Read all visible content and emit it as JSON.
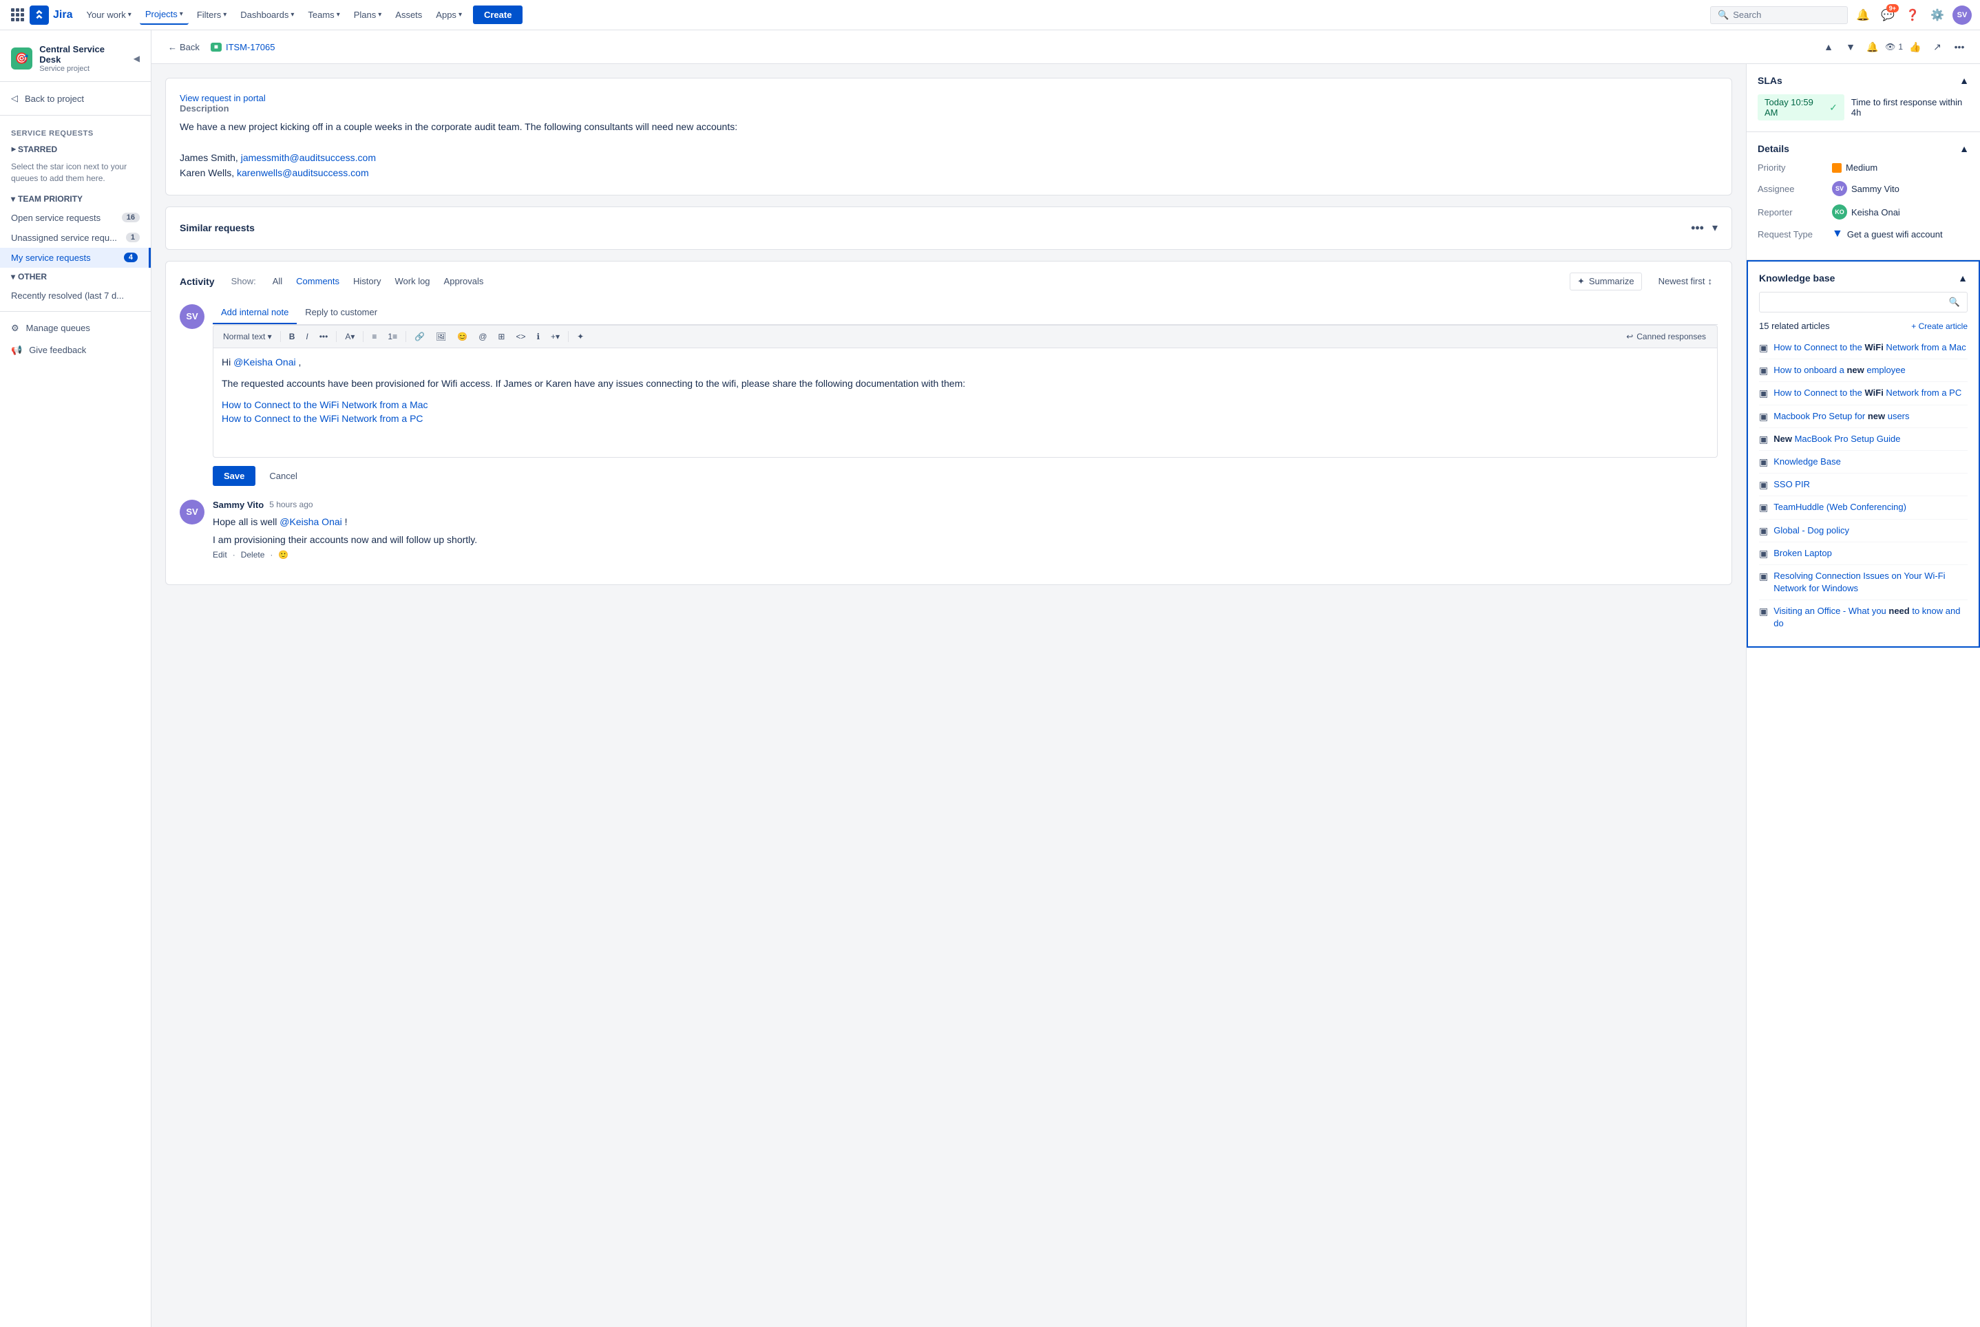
{
  "topnav": {
    "app_name": "Jira",
    "logo_text": "Jira",
    "nav_items": [
      {
        "id": "your-work",
        "label": "Your work",
        "has_chevron": true
      },
      {
        "id": "projects",
        "label": "Projects",
        "has_chevron": true,
        "active": true
      },
      {
        "id": "filters",
        "label": "Filters",
        "has_chevron": true
      },
      {
        "id": "dashboards",
        "label": "Dashboards",
        "has_chevron": true
      },
      {
        "id": "teams",
        "label": "Teams",
        "has_chevron": true
      },
      {
        "id": "plans",
        "label": "Plans",
        "has_chevron": true
      },
      {
        "id": "assets",
        "label": "Assets",
        "has_chevron": false
      },
      {
        "id": "apps",
        "label": "Apps",
        "has_chevron": true
      }
    ],
    "create_label": "Create",
    "search_placeholder": "Search",
    "notification_count": "9+"
  },
  "sidebar": {
    "project_name": "Central Service Desk",
    "project_type": "Service project",
    "back_to_project": "Back to project",
    "section_service_requests": "Service requests",
    "section_starred": "STARRED",
    "starred_hint": "Select the star icon next to your queues to add them here.",
    "section_team_priority": "TEAM PRIORITY",
    "queues": [
      {
        "label": "Open service requests",
        "count": "16",
        "active": false
      },
      {
        "label": "Unassigned service requ...",
        "count": "1",
        "active": false
      },
      {
        "label": "My service requests",
        "count": "4",
        "active": true
      }
    ],
    "section_other": "OTHER",
    "other_items": [
      {
        "label": "Recently resolved (last 7 d...",
        "active": false
      }
    ],
    "manage_queues": "Manage queues",
    "give_feedback": "Give feedback"
  },
  "breadcrumb": {
    "back_label": "Back",
    "issue_key": "ITSM-17065",
    "issue_key_badge": "ITSM"
  },
  "issue": {
    "view_portal_link": "View request in portal",
    "description_label": "Description",
    "description_text": "We have a new project kicking off in a couple weeks in the corporate audit team. The following consultants will need new accounts:",
    "description_names": [
      "James Smith, jamessmith@auditsuccess.com",
      "Karen Wells, karenwells@auditsuccess.com"
    ],
    "similar_requests_label": "Similar requests",
    "activity_label": "Activity",
    "show_label": "Show:",
    "filter_tabs": [
      {
        "label": "All",
        "active": false
      },
      {
        "label": "Comments",
        "active": true
      },
      {
        "label": "History",
        "active": false
      },
      {
        "label": "Work log",
        "active": false
      },
      {
        "label": "Approvals",
        "active": false
      }
    ],
    "summarize_label": "Summarize",
    "sort_label": "Newest first",
    "add_internal_note": "Add internal note",
    "reply_to_customer": "Reply to customer",
    "editor_format": "Normal text",
    "canned_responses": "Canned responses",
    "editor_greeting": "Hi @Keisha Onai ,",
    "editor_body": "The requested accounts have been provisioned for Wifi access. If James or Karen have any issues connecting to the wifi, please share the following documentation with them:",
    "editor_links": [
      "How to Connect to the WiFi Network from a Mac",
      "How to Connect to the WiFi Network from a PC"
    ],
    "save_label": "Save",
    "cancel_label": "Cancel"
  },
  "comment": {
    "author": "Sammy Vito",
    "time": "5 hours ago",
    "text1": "Hope all is well @Keisha Onai !",
    "text2": "I am provisioning their accounts now and will follow up shortly.",
    "action_edit": "Edit",
    "action_delete": "Delete",
    "action_dot": "·"
  },
  "right_panel": {
    "sla_title": "SLAs",
    "sla_time": "Today 10:59 AM",
    "sla_label": "Time to first response within 4h",
    "details_title": "Details",
    "priority_label": "Priority",
    "priority_value": "Medium",
    "assignee_label": "Assignee",
    "assignee_name": "Sammy Vito",
    "reporter_label": "Reporter",
    "reporter_name": "Keisha Onai",
    "request_type_label": "Request Type",
    "request_type_value": "Get a guest wifi account",
    "kb_title": "Knowledge base",
    "kb_articles_count": "15 related articles",
    "create_article_label": "+ Create article",
    "kb_articles": [
      {
        "id": 1,
        "title": "How to Connect to the ",
        "bold": "WiFi",
        "rest": " Network from a Mac"
      },
      {
        "id": 2,
        "title": "How to onboard a ",
        "bold": "new",
        "rest": " employee"
      },
      {
        "id": 3,
        "title": "How to Connect to the ",
        "bold": "WiFi",
        "rest": " Network from a PC"
      },
      {
        "id": 4,
        "title": "Macbook Pro Setup for ",
        "bold": "new",
        "rest": " users"
      },
      {
        "id": 5,
        "title": "",
        "bold": "New",
        "rest": " MacBook Pro Setup Guide"
      },
      {
        "id": 6,
        "title": "Knowledge Base",
        "bold": "",
        "rest": ""
      },
      {
        "id": 7,
        "title": "SSO PIR",
        "bold": "",
        "rest": ""
      },
      {
        "id": 8,
        "title": "TeamHuddle (Web Conferencing)",
        "bold": "",
        "rest": ""
      },
      {
        "id": 9,
        "title": "Global - Dog policy",
        "bold": "",
        "rest": ""
      },
      {
        "id": 10,
        "title": "Broken Laptop",
        "bold": "",
        "rest": ""
      },
      {
        "id": 11,
        "title": "Resolving Connection Issues on Your Wi-Fi Network for Windows",
        "bold": "",
        "rest": ""
      },
      {
        "id": 12,
        "title": "Visiting an Office - What you ",
        "bold": "need",
        "rest": " to know and do"
      }
    ]
  }
}
